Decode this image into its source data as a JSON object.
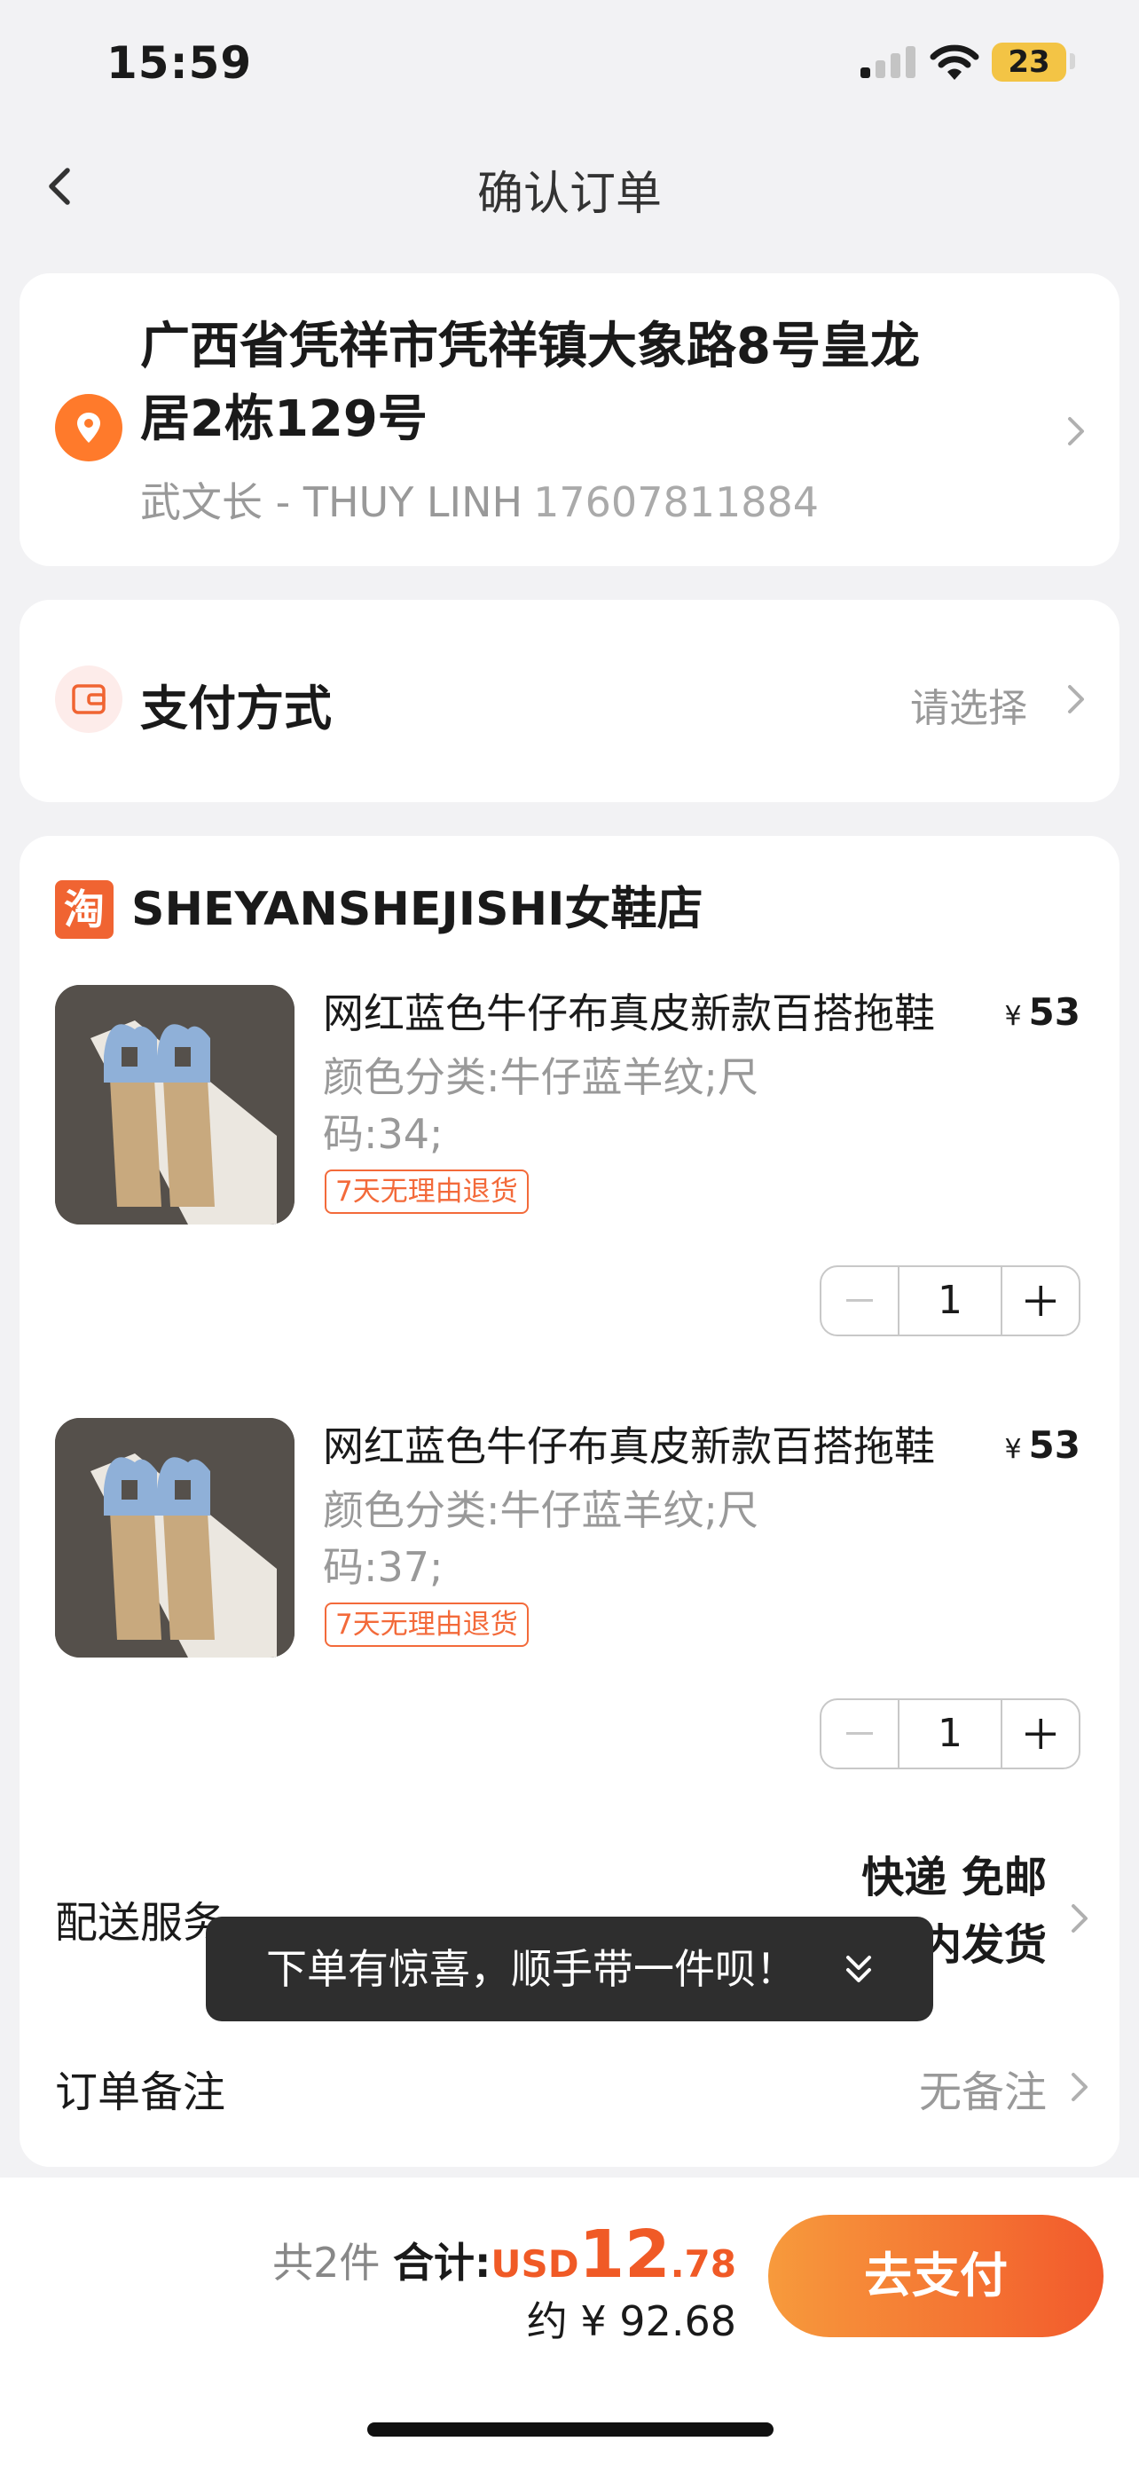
{
  "status_bar": {
    "time": "15:59",
    "battery": "23",
    "icons": [
      "signal-icon",
      "wifi-icon",
      "battery-icon"
    ]
  },
  "nav": {
    "title": "确认订单",
    "back_icon": "chevron-left-icon"
  },
  "address": {
    "line1": "广西省凭祥市凭祥镇大象路8号皇龙",
    "line2": "居2栋129号",
    "name": "武文长 - THUY LINH",
    "phone": "17607811884",
    "icon": "location-pin-icon"
  },
  "payment": {
    "label": "支付方式",
    "value": "请选择",
    "icon": "wallet-icon"
  },
  "shop": {
    "logo_text": "淘",
    "name": "SHEYANSHEJISHI女鞋店",
    "items": [
      {
        "title": "网红蓝色牛仔布真皮新款百搭拖鞋",
        "price_currency": "¥",
        "price": "53",
        "spec_line1": "颜色分类:牛仔蓝羊纹;尺",
        "spec_line2": "码:34;",
        "tag": "7天无理由退货",
        "qty": "1"
      },
      {
        "title": "网红蓝色牛仔布真皮新款百搭拖鞋",
        "price_currency": "¥",
        "price": "53",
        "spec_line1": "颜色分类:牛仔蓝羊纹;尺",
        "spec_line2": "码:37;",
        "tag": "7天无理由退货",
        "qty": "1"
      }
    ],
    "delivery_label": "配送服务",
    "delivery_value_line1": "快递 免邮",
    "delivery_value_line2": "内发货",
    "note_label": "订单备注",
    "note_value": "无备注"
  },
  "toast": {
    "text": "下单有惊喜，顺手带一件呗！",
    "icon": "double-chevron-down-icon"
  },
  "bottom": {
    "count": "共2件",
    "total_label": "合计:",
    "currency": "USD",
    "amount_int": "12",
    "amount_dec": ".78",
    "approx": "约 ¥ 92.68",
    "pay_button": "去支付"
  },
  "colors": {
    "accent": "#f05a26",
    "button_start": "#f79a3c",
    "button_end": "#f25a2c",
    "battery": "#f3c445"
  }
}
